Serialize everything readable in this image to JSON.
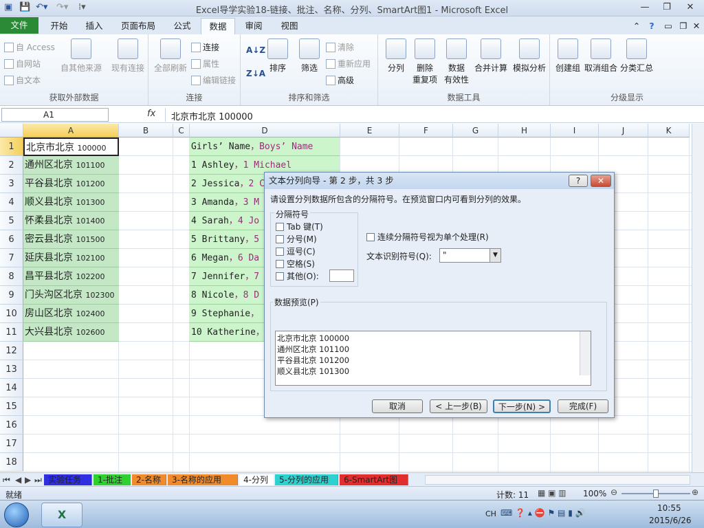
{
  "window": {
    "title": "Excel导学实验18-链接、批注、名称、分列、SmartArt图1 - Microsoft Excel"
  },
  "ribbon": {
    "tabs": [
      "文件",
      "开始",
      "插入",
      "页面布局",
      "公式",
      "数据",
      "审阅",
      "视图"
    ],
    "active_tab": "数据",
    "groups": {
      "external": {
        "label": "获取外部数据",
        "from_access": "自 Access",
        "from_web": "自网站",
        "from_text": "自文本",
        "other_sources": "自其他来源",
        "existing": "现有连接"
      },
      "connections": {
        "label": "连接",
        "refresh_all": "全部刷新",
        "connections": "连接",
        "properties": "属性",
        "edit_links": "编辑链接"
      },
      "sort_filter": {
        "label": "排序和筛选",
        "sort": "排序",
        "filter": "筛选",
        "clear": "清除",
        "reapply": "重新应用",
        "advanced": "高级"
      },
      "data_tools": {
        "label": "数据工具",
        "text_to_columns": "分列",
        "remove_dup_1": "删除",
        "remove_dup_2": "重复项",
        "validation_1": "数据",
        "validation_2": "有效性",
        "consolidate": "合并计算",
        "what_if": "模拟分析"
      },
      "outline": {
        "label": "分级显示",
        "group": "创建组",
        "ungroup": "取消组合",
        "subtotal": "分类汇总"
      }
    }
  },
  "formula_bar": {
    "name_box": "A1",
    "fx": "fx",
    "content": "北京市北京 100000"
  },
  "columns": [
    "A",
    "B",
    "C",
    "D",
    "E",
    "F",
    "G",
    "H",
    "I",
    "J",
    "K"
  ],
  "rows": [
    "1",
    "2",
    "3",
    "4",
    "5",
    "6",
    "7",
    "8",
    "9",
    "10",
    "11",
    "12",
    "13",
    "14",
    "15",
    "16",
    "17",
    "18"
  ],
  "column_a": [
    {
      "city": "北京市北京",
      "code": "100000"
    },
    {
      "city": "通州区北京",
      "code": "101100"
    },
    {
      "city": "平谷县北京",
      "code": "101200"
    },
    {
      "city": "顺义县北京",
      "code": "101300"
    },
    {
      "city": "怀柔县北京",
      "code": "101400"
    },
    {
      "city": "密云县北京",
      "code": "101500"
    },
    {
      "city": "延庆县北京",
      "code": "102100"
    },
    {
      "city": "昌平县北京",
      "code": "102200"
    },
    {
      "city": "门头沟区北京",
      "code": "102300"
    },
    {
      "city": "房山区北京",
      "code": "102400"
    },
    {
      "city": "大兴县北京",
      "code": "102600"
    }
  ],
  "column_d": [
    {
      "a": "Girls’ Name",
      "sep": "，",
      "b": "Boys’ Name"
    },
    {
      "a": "1 Ashley",
      "sep": "，",
      "b": "1 Michael"
    },
    {
      "a": "2 Jessica",
      "sep": "，",
      "b": "2 C"
    },
    {
      "a": "3 Amanda",
      "sep": "，",
      "b": "3 M"
    },
    {
      "a": "4 Sarah",
      "sep": "，",
      "b": "4 Jo"
    },
    {
      "a": "5 Brittany",
      "sep": "，",
      "b": "5"
    },
    {
      "a": "6 Megan",
      "sep": "，",
      "b": "6 Da"
    },
    {
      "a": "7 Jennifer",
      "sep": "，",
      "b": "7"
    },
    {
      "a": "8 Nicole",
      "sep": "，",
      "b": "8 D"
    },
    {
      "a": "9 Stephanie",
      "sep": "，",
      "b": ""
    },
    {
      "a": "10 Katherine",
      "sep": "，",
      "b": ""
    }
  ],
  "dialog": {
    "title": "文本分列向导 - 第 2 步，共 3 步",
    "help": "?",
    "instructions": "请设置分列数据所包含的分隔符号。在预览窗口内可看到分列的效果。",
    "delimiters_label": "分隔符号",
    "tab": "Tab 键(T)",
    "semicolon": "分号(M)",
    "comma": "逗号(C)",
    "space": "空格(S)",
    "other": "其他(O):",
    "consecutive": "连续分隔符号视为单个处理(R)",
    "qualifier_label": "文本识别符号(Q):",
    "qualifier_value": "\"",
    "preview_label": "数据预览(P)",
    "preview_rows": [
      "北京市北京 100000",
      "通州区北京 101100",
      "平谷县北京 101200",
      "顺义县北京 101300"
    ],
    "cancel": "取消",
    "back": "< 上一步(B)",
    "next": "下一步(N) >",
    "finish": "完成(F)"
  },
  "sheets": [
    "实验任务",
    "1-批注",
    "2-名称",
    "3-名称的应用",
    "4-分列",
    "5-分列的应用",
    "6-SmartArt图"
  ],
  "sheet_colors": [
    "#2f2fe0",
    "#2fd02f",
    "#f08a2a",
    "#f08a2a",
    "#ffffff",
    "#2fd0d0",
    "#e02f2f"
  ],
  "active_sheet": "4-分列",
  "status": {
    "ready": "就绪",
    "count": "计数: 11",
    "zoom": "100%"
  },
  "taskbar": {
    "lang": "CH",
    "time": "10:55",
    "date": "2015/6/26"
  }
}
